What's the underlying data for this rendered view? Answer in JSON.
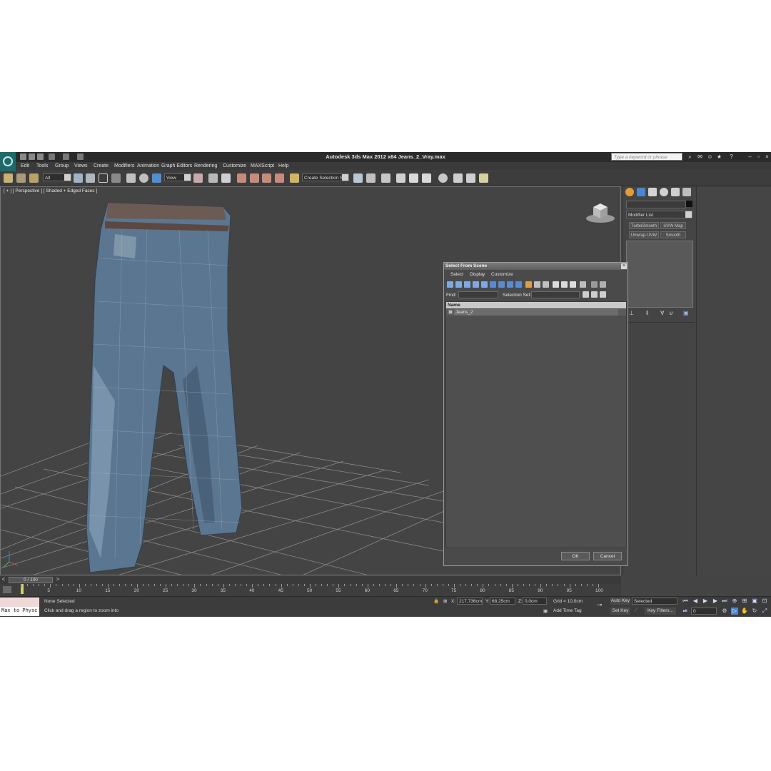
{
  "window": {
    "title": "Autodesk 3ds Max  2012 x64     Jeans_2_Vray.max",
    "search_placeholder": "Type a keyword or phrase"
  },
  "menu": [
    "Edit",
    "Tools",
    "Group",
    "Views",
    "Create",
    "Modifiers",
    "Animation",
    "Graph Editors",
    "Rendering",
    "Customize",
    "MAXScript",
    "Help"
  ],
  "toolbar": {
    "filter": "All",
    "ref_coord": "View",
    "selection_set": "Create Selection Se"
  },
  "viewport": {
    "label": "[ + ] [ Perspective ] [ Shaded + Edged Faces ]"
  },
  "command_panel": {
    "modifier_list": "Modifier List",
    "buttons": [
      "TurboSmooth",
      "UVW Map",
      "Unwrap UVW",
      "Smooth"
    ]
  },
  "dialog": {
    "title": "Select From Scene",
    "menu": [
      "Select",
      "Display",
      "Customize"
    ],
    "find_label": "Find:",
    "selection_set_label": "Selection Set:",
    "column_name": "Name",
    "objects": [
      "Jeans_2"
    ],
    "ok": "OK",
    "cancel": "Cancel"
  },
  "timeline": {
    "slider": "0 / 100",
    "ticks": [
      "5",
      "10",
      "15",
      "20",
      "25",
      "30",
      "35",
      "40",
      "45",
      "50",
      "55",
      "60",
      "65",
      "70",
      "75",
      "80",
      "85",
      "90",
      "95",
      "100"
    ]
  },
  "status": {
    "maxscript": "Max to Physc",
    "selection": "None Selected",
    "prompt": "Click and drag a region to zoom into",
    "x_label": "X:",
    "x_value": "217,736cm",
    "y_label": "Y:",
    "y_value": "68,25cm",
    "z_label": "Z:",
    "z_value": "0,0cm",
    "grid": "Grid = 10,0cm",
    "add_time_tag": "Add Time Tag",
    "auto_key": "Auto Key",
    "set_key": "Set Key",
    "key_mode": "Selected",
    "key_filters": "Key Filters...",
    "frame": "0"
  }
}
